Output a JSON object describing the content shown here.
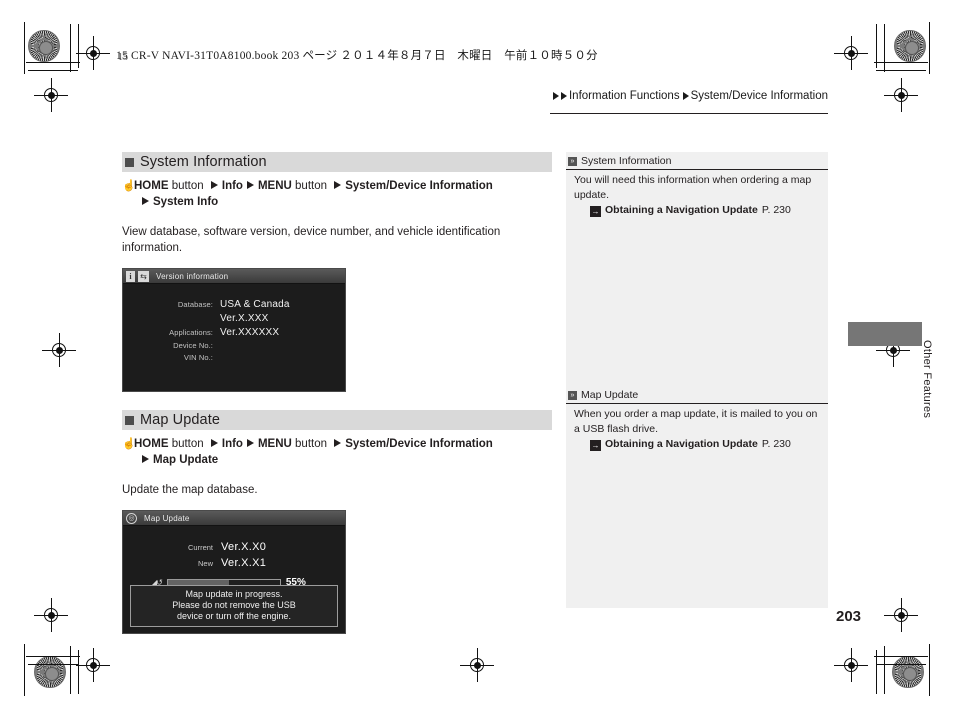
{
  "print_marks": {
    "book_line": "15 CR-V NAVI-31T0A8100.book   203 ページ   ２０１４年８月７日　木曜日　午前１０時５０分",
    "plate_number": "15"
  },
  "breadcrumb": {
    "arrow_icon": "triangle-right-icon",
    "items": [
      "Information Functions",
      "System/Device Information"
    ]
  },
  "sections": [
    {
      "id": "system-information",
      "heading": "System Information",
      "path": {
        "hand_icon": "hand-pointer-icon",
        "tokens": [
          "HOME",
          "button",
          "Info",
          "MENU",
          "button",
          "System/Device Information",
          "System Info"
        ],
        "line1_a": "HOME",
        "line1_b": " button ",
        "line1_c": "Info",
        "line1_d": "MENU",
        "line1_e": " button ",
        "line1_f": "System/Device Information",
        "line2": "System Info"
      },
      "body": "View database, software version, device number, and vehicle identification information.",
      "screen": {
        "title": "Version information",
        "icon_info": "i",
        "icon_back": "⇆",
        "rows": [
          {
            "label": "Database:",
            "value": "USA & Canada"
          },
          {
            "label": "",
            "value": "Ver.X.XXX"
          },
          {
            "label": "Applications:",
            "value": "Ver.XXXXXX"
          },
          {
            "label": "Device No.:",
            "value": ""
          },
          {
            "label": "VIN No.:",
            "value": ""
          }
        ]
      }
    },
    {
      "id": "map-update",
      "heading": "Map Update",
      "path": {
        "hand_icon": "hand-pointer-icon",
        "line1_a": "HOME",
        "line1_b": " button ",
        "line1_c": "Info",
        "line1_d": "MENU",
        "line1_e": " button ",
        "line1_f": "System/Device Information",
        "line2": "Map Update"
      },
      "body": "Update the map database.",
      "screen": {
        "title": "Map Update",
        "icon_circle": "◎",
        "rows": [
          {
            "label": "Current",
            "value": "Ver.X.X0"
          },
          {
            "label": "New",
            "value": "Ver.X.X1"
          }
        ],
        "progress": {
          "icon": "usb-refresh-icon",
          "percent_label": "55%",
          "percent_value": 55
        },
        "message_lines": [
          "Map update in progress.",
          "Please do not remove the USB",
          "device or turn off the engine."
        ]
      }
    }
  ],
  "notes": [
    {
      "badge_icon": "note-marker-icon",
      "title": "System Information",
      "body": "You will need this information when ordering a map update.",
      "xref": {
        "jump_icon": "jump-arrow-icon",
        "label": "Obtaining a Navigation Update",
        "page": "P. 230"
      }
    },
    {
      "badge_icon": "note-marker-icon",
      "title": "Map Update",
      "body": "When you order a map update, it is mailed to you on a USB flash drive.",
      "xref": {
        "jump_icon": "jump-arrow-icon",
        "label": "Obtaining a Navigation Update",
        "page": "P. 230"
      }
    }
  ],
  "side_tab": {
    "label": "Other Features"
  },
  "page_number": "203"
}
